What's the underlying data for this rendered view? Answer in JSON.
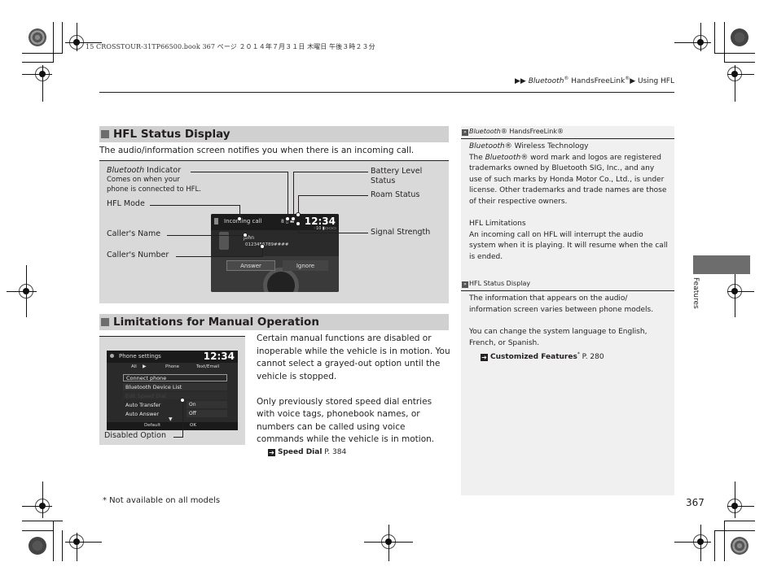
{
  "print_header": "15 CROSSTOUR-31TP66500.book  367 ページ  ２０１４年７月３１日  木曜日  午後３時２３分",
  "breadcrumb": {
    "part1": "Bluetooth",
    "reg1": "®",
    "part2": " HandsFreeLink",
    "reg2": "®",
    "part3": "Using HFL"
  },
  "sections": {
    "hfl_status": {
      "title": "HFL Status Display",
      "intro": "The audio/information screen notifies you when there is an incoming call.",
      "callouts": {
        "bt_indicator_italic": "Bluetooth",
        "bt_indicator_rest": " Indicator",
        "bt_indicator_desc_1": "Comes on when your",
        "bt_indicator_desc_2": "phone is connected to HFL.",
        "hfl_mode": "HFL Mode",
        "callers_name": "Caller's Name",
        "callers_number": "Caller's Number",
        "battery_level_1": "Battery Level",
        "battery_level_2": "Status",
        "roam_status": "Roam Status",
        "signal_strength": "Signal Strength"
      },
      "screen": {
        "title": "Incoming call",
        "time": "12:34",
        "caller_name": "John",
        "caller_number": "0123456789####",
        "answer_label": "Answer",
        "ignore_label": "Ignore",
        "signal_label": "·1•0"
      }
    },
    "limitations": {
      "title": "Limitations for Manual Operation",
      "paragraph1": "Certain manual functions are disabled or inoperable while the vehicle is in motion. You cannot select a grayed-out option until the vehicle is stopped.",
      "paragraph2": "Only previously stored speed dial entries with voice tags, phonebook names, or numbers can be called using voice commands while the vehicle is in motion.",
      "xref_label": "Speed Dial",
      "xref_page": " P. 384",
      "callout_disabled": "Disabled Option",
      "screen": {
        "title": "Phone settings",
        "time": "12:34",
        "tabs": [
          "All",
          "Phone",
          "Text/Email"
        ],
        "rows": [
          {
            "label": "Connect phone",
            "value": ""
          },
          {
            "label": "Bluetooth Device List",
            "value": ""
          },
          {
            "label": "Edit Speed Dial",
            "value": ""
          },
          {
            "label": "Auto Transfer",
            "value": "On"
          },
          {
            "label": "Auto Answer",
            "value": "Off"
          }
        ],
        "bottom_buttons": [
          "Default",
          "OK"
        ]
      }
    }
  },
  "sidebar": {
    "block1": {
      "head_italic": "Bluetooth",
      "head_rest": "® HandsFreeLink®",
      "line1_italic": "Bluetooth",
      "line1_rest": "® Wireless Technology",
      "para1_a": "The ",
      "para1_italic": "Bluetooth",
      "para1_b": "® word mark and logos are registered trademarks owned by Bluetooth SIG, Inc., and any use of such marks by Honda Motor Co., Ltd., is under license. Other trademarks and trade names are those of their respective owners.",
      "subhead": "HFL Limitations",
      "para2": "An incoming call on HFL will interrupt the audio system when it is playing. It will resume when the call is ended."
    },
    "block2": {
      "head": "HFL Status Display",
      "para1": "The information that appears on the audio/ information screen varies between phone models.",
      "para2": "You can change the system language to English, French, or Spanish.",
      "xref_label": "Customized Features",
      "xref_star": "*",
      "xref_page": " P. 280"
    }
  },
  "tab_label": "Features",
  "footnote": "* Not available on all models",
  "page_number": "367",
  "icons": {
    "breadcrumb_arrow": "▶",
    "xref_arrow": "➔",
    "sidebar_chevron": "»"
  }
}
